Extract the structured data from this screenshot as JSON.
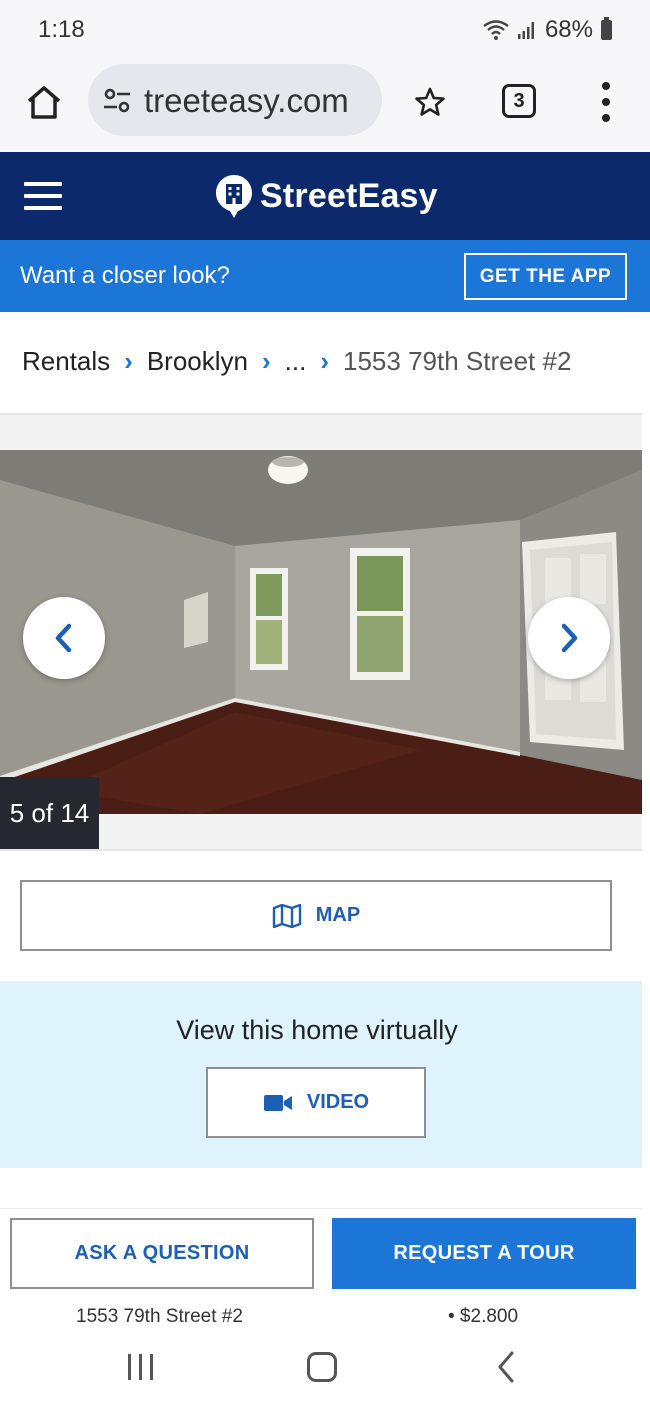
{
  "status": {
    "time": "1:18",
    "battery": "68%"
  },
  "browser": {
    "url": "treeteasy.com",
    "tab_count": "3"
  },
  "site": {
    "logo_text": "StreetEasy",
    "brand_color": "#0c2a6b",
    "accent_color": "#1c76d8"
  },
  "banner": {
    "text": "Want a closer look?",
    "button": "GET THE APP"
  },
  "breadcrumb": {
    "items": [
      "Rentals",
      "Brooklyn",
      "...",
      "1553 79th Street #2"
    ]
  },
  "gallery": {
    "counter": "5 of 14",
    "current": 5,
    "total": 14
  },
  "map": {
    "label": "MAP",
    "icon": "map-icon"
  },
  "virtual": {
    "title": "View this home virtually",
    "video_label": "VIDEO",
    "icon": "video-camera-icon"
  },
  "actions": {
    "ask": "ASK A QUESTION",
    "tour": "REQUEST A TOUR"
  },
  "listing_peek": {
    "address": "1553 79th Street #2",
    "price": "• $2,800"
  }
}
